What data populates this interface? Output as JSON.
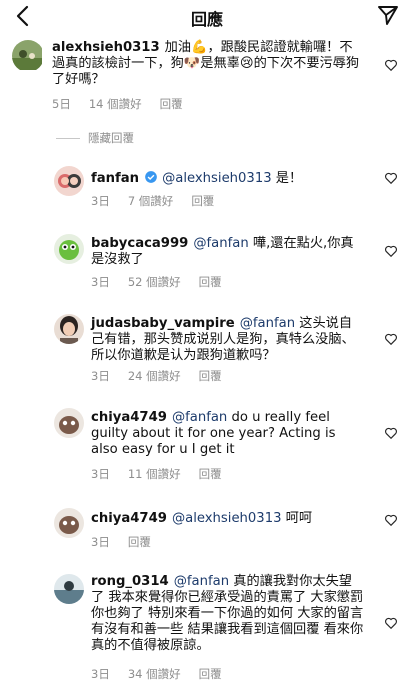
{
  "header": {
    "title": "回應"
  },
  "hide_replies_label": "隱藏回覆",
  "comments": [
    {
      "username": "alexhsieh0313",
      "text": "加油💪，跟酸民認證就輸囉！不過真的該檢討一下，狗🐶是無辜😢的下次不要污辱狗了好嗎？",
      "time": "5日",
      "likes": "14 個讚好",
      "reply": "回覆"
    },
    {
      "username": "fanfan",
      "verified": true,
      "mention": "@alexhsieh0313",
      "text": " 是！",
      "time": "3日",
      "likes": "7 個讚好",
      "reply": "回覆"
    },
    {
      "username": "babycaca999",
      "mention": "@fanfan",
      "text": " 嘩,還在點火,你真是沒救了",
      "time": "3日",
      "likes": "52 個讚好",
      "reply": "回覆"
    },
    {
      "username": "judasbaby_vampire",
      "mention": "@fanfan",
      "text": " 这头说自己有错，那头赞成说别人是狗，真特么没脑、所以你道歉是认为跟狗道歉吗？",
      "time": "3日",
      "likes": "24 個讚好",
      "reply": "回覆"
    },
    {
      "username": "chiya4749",
      "mention": "@fanfan",
      "text": " do u really feel guilty about it for one year? Acting is also easy for u I get it",
      "time": "3日",
      "likes": "11 個讚好",
      "reply": "回覆"
    },
    {
      "username": "chiya4749",
      "mention": "@alexhsieh0313",
      "text": " 呵呵",
      "time": "3日",
      "likes": "",
      "reply": "回覆"
    },
    {
      "username": "rong_0314",
      "mention": "@fanfan",
      "text": " 真的讓我對你太失望了 我本來覺得你已經承受過的責罵了 大家懲罰你也夠了 特別來看一下你過的如何 大家的留言有沒有和善一些 結果讓我看到這個回覆 看來你真的不值得被原諒。",
      "time": "3日",
      "likes": "34 個讚好",
      "reply": "回覆"
    }
  ],
  "colors": {
    "mention": "#1d3b6b",
    "meta": "#8e8e8e",
    "verified": "#3897f0"
  }
}
